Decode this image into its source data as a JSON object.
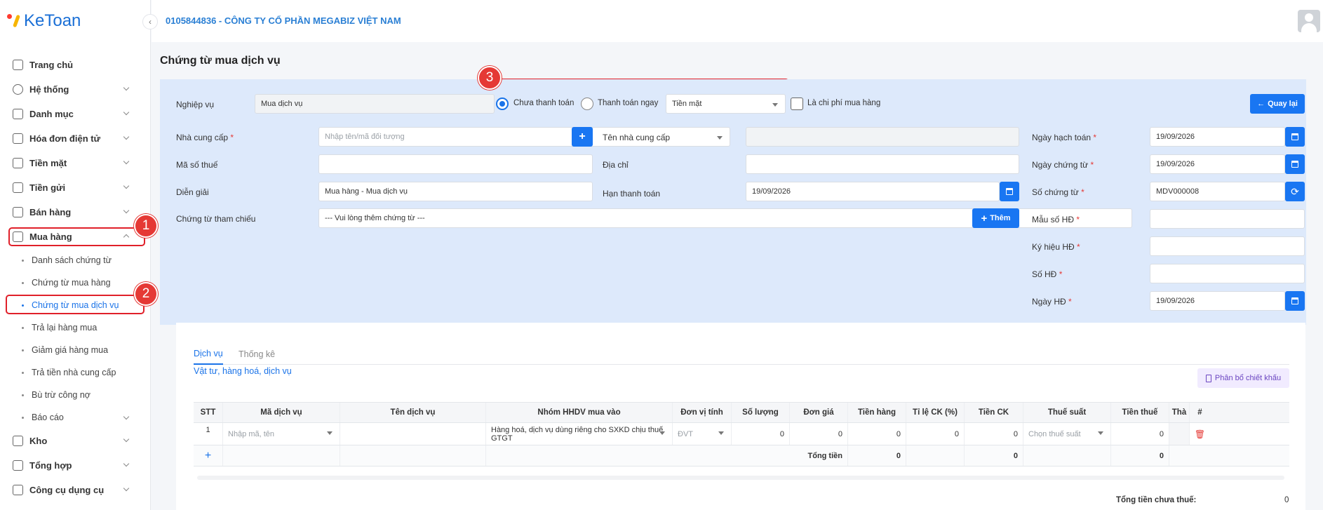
{
  "brand": {
    "name": "KeToan"
  },
  "header": {
    "company": "0105844836 - CÔNG TY CỔ PHẦN MEGABIZ VIỆT NAM"
  },
  "sidebar": {
    "items": [
      {
        "label": "Trang chủ"
      },
      {
        "label": "Hệ thống"
      },
      {
        "label": "Danh mục"
      },
      {
        "label": "Hóa đơn điện tử"
      },
      {
        "label": "Tiền mặt"
      },
      {
        "label": "Tiền gửi"
      },
      {
        "label": "Bán hàng"
      },
      {
        "label": "Mua hàng"
      },
      {
        "label": "Kho"
      },
      {
        "label": "Tổng hợp"
      },
      {
        "label": "Công cụ dụng cụ"
      }
    ],
    "sub": [
      {
        "label": "Danh sách chứng từ"
      },
      {
        "label": "Chứng từ mua hàng"
      },
      {
        "label": "Chứng từ mua dịch vụ"
      },
      {
        "label": "Trả lại hàng mua"
      },
      {
        "label": "Giảm giá hàng mua"
      },
      {
        "label": "Trả tiền nhà cung cấp"
      },
      {
        "label": "Bù trừ công nợ"
      },
      {
        "label": "Báo cáo"
      }
    ]
  },
  "badges": [
    "1",
    "2",
    "3"
  ],
  "page": {
    "title": "Chứng từ mua dịch vụ"
  },
  "form": {
    "nghiep_vu": {
      "label": "Nghiệp vụ",
      "value": "Mua dịch vụ"
    },
    "payment": {
      "unpaid": "Chưa thanh toán",
      "paid_now": "Thanh toán ngay",
      "method": "Tiền mặt"
    },
    "is_expense": "Là chi phí mua hàng",
    "back": "Quay lại",
    "req_mark": "*",
    "supplier": {
      "label": "Nhà cung cấp",
      "placeholder": "Nhập tên/mã đối tượng"
    },
    "supplier_name": {
      "label": "Tên nhà cung cấp"
    },
    "tax_code": {
      "label": "Mã số thuế"
    },
    "address": {
      "label": "Địa chỉ"
    },
    "description": {
      "label": "Diễn giải",
      "value": "Mua hàng - Mua dịch vụ"
    },
    "due_date": {
      "label": "Hạn thanh toán",
      "value": "19/09/2026"
    },
    "ref": {
      "label": "Chứng từ tham chiếu",
      "placeholder": "--- Vui lòng thêm chứng từ ---",
      "add": "Thêm"
    },
    "posting_date": {
      "label": "Ngày hạch toán",
      "value": "19/09/2026"
    },
    "doc_date": {
      "label": "Ngày chứng từ",
      "value": "19/09/2026"
    },
    "doc_no": {
      "label": "Số chứng từ",
      "value": "MDV000008"
    },
    "invoice_form": {
      "label": "Mẫu số HĐ"
    },
    "invoice_symbol": {
      "label": "Ký hiệu HĐ"
    },
    "invoice_no": {
      "label": "Số HĐ"
    },
    "invoice_date": {
      "label": "Ngày HĐ",
      "value": "19/09/2026"
    }
  },
  "detail": {
    "tabs": [
      "Dịch vụ",
      "Thống kê"
    ],
    "section": "Vật tư, hàng hoá, dịch vụ",
    "allocate": "Phân bổ chiết khấu",
    "columns": [
      "STT",
      "Mã dịch vụ",
      "Tên dịch vụ",
      "Nhóm HHDV mua vào",
      "Đơn vị tính",
      "Số lượng",
      "Đơn giá",
      "Tiền hàng",
      "Tỉ lệ CK (%)",
      "Tiền CK",
      "Thuế suất",
      "Tiền thuế",
      "Thà",
      "#"
    ],
    "row": {
      "stt": "1",
      "code_ph": "Nhập mã, tên",
      "group": "Hàng hoá, dịch vụ dùng riêng cho SXKD chịu thuế GTGT",
      "unit_ph": "ĐVT",
      "qty": "0",
      "price": "0",
      "amount": "0",
      "ck_rate": "0",
      "ck": "0",
      "tax_ph": "Chọn thuế suất",
      "tax": "0"
    },
    "totals": {
      "label": "Tổng tiền",
      "amount": "0",
      "ck": "0",
      "tax": "0"
    },
    "pre_tax_label": "Tổng tiền chưa thuế:",
    "pre_tax_value": "0"
  }
}
